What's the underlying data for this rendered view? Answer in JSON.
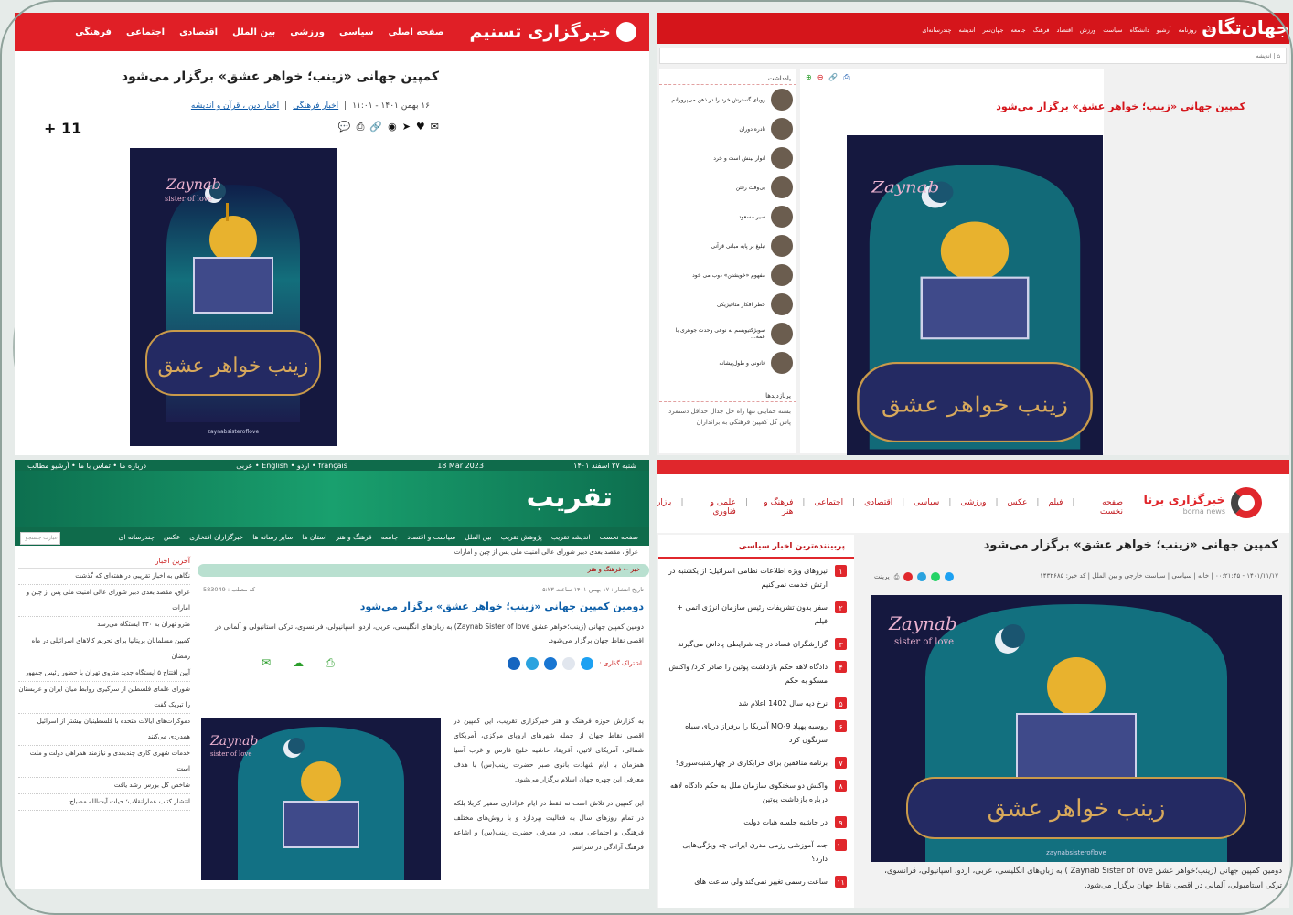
{
  "poster": {
    "brand": "Zaynab",
    "brand_sub": "sister of love",
    "calligraphy": "زینب خواهر عشق",
    "handle": "zaynabsisteroflove"
  },
  "tasnim": {
    "logo": "خبرگزاری تسنیم",
    "nav": [
      "صفحه اصلی",
      "سیاسی",
      "ورزشی",
      "بین الملل",
      "اقتصادی",
      "اجتماعی",
      "فرهنگی"
    ],
    "title": "کمپین جهانی «زینب؛ خواهر عشق» برگزار می‌شود",
    "date": "۱۶ بهمن ۱۴۰۱ - ۱۱:۰۱",
    "cat1": "اخبار فرهنگی",
    "cat2": "اخبار دین ، قرآن و اندیشه",
    "zoom": "+ 11"
  },
  "jahan": {
    "logo": "جهان‌تگان",
    "nav": [
      "خانه",
      "روزنامه",
      "آرشیو",
      "دانشگاه",
      "سیاست",
      "ورزش",
      "اقتصاد",
      "فرهنگ",
      "جامعه",
      "جهان‌نمر",
      "اندیشه",
      "چندرسانه‌ای"
    ],
    "crumb": "اندیشه",
    "title": "کمپین جهانی «زینب؛ خواهر عشق» برگزار می‌شود",
    "sec1": "یادداشت",
    "items": [
      "رویای گسترش خرد را در ذهن می‌پرورانم",
      "نادره دوران",
      "انوار بینش است و خرد",
      "بی‌وقت رفتن",
      "سیر مسعود",
      "تبلیغ بر پایه مبانی قرآنی",
      "مفهوم «خویشتن» دوب می خود",
      "خطر افکار متافیزیکی",
      "سوبژکتیویسم به نوعی وحدت جوهری با عمه...",
      "قانونی و طول‌پیشانه"
    ],
    "sec2": "پربازدیدها",
    "pop": [
      "بسته حمایتی تنها راه حل جدال حداقل دستمزد",
      "پاس گل کمپین فرهنگی به برانداران"
    ]
  },
  "taghrib": {
    "date_fa": "شنبه ۲۷ اسفند ۱۴۰۱",
    "date_en": "18 Mar 2023",
    "langs": "عربی • English • اردو • français",
    "top_links": "درباره ما • تماس با ما • آرشیو مطالب",
    "logo": "تقریب",
    "nav": [
      "صفحه نخست",
      "اندیشه تقریب",
      "پژوهش تقریب",
      "بین الملل",
      "سیاست و اقتصاد",
      "جامعه",
      "فرهنگ و هنر",
      "استان ها",
      "سایر رسانه ها",
      "خبرگزاران افتخاری",
      "عکس",
      "چندرسانه ای"
    ],
    "search_placeholder": "عبارت جستجو",
    "ticker": "عراق، مقصد بعدی دبیر شورای عالی امنیت ملی پس از چین و امارات",
    "crumb": "خبر  ←  فرهنگ و هنر",
    "code": "کد مطلب : 583049",
    "pubdate": "تاریخ انتشار : ۱۷ بهمن ۱۴۰۱ ساعت ۵:۲۳",
    "title": "دومین کمپین جهانی «زینب؛ خواهر عشق» برگزار می‌شود",
    "lead": "دومین کمپین جهانی (زینب؛خواهر عشق Zaynab Sister of love) به زبان‌های انگلیسی، عربی، اردو، اسپانیولی، فرانسوی، ترکی استانبولی و آلمانی در اقصی نقاط جهان برگزار می‌شود.",
    "share": "اشتراک گذاری :",
    "body1": "به گزارش حوزه فرهنگ و هنر خبرگزاری تقریب، این کمپین در اقصی نقاط جهان از جمله شهرهای اروپای مرکزی، آمریکای شمالی، آمریکای لاتین، آفریقا، حاشیه خلیج فارس و غرب آسیا همزمان با ایام شهادت بانوی صبر حضرت زینب(س) با هدف معرفی این چهره جهان اسلام برگزار می‌شود.",
    "body2": "این کمپین در تلاش است نه فقط در ایام عزاداری سفیر کربلا بلکه در تمام روزهای سال به فعالیت بپردازد و با روش‌های مختلف فرهنگی و اجتماعی سعی در معرفی حضرت زینب(س) و اشاعه فرهنگ آزادگی در سراسر",
    "latest_h": "آخرین اخبار",
    "latest": [
      "نگاهی به اخبار تقریبی در هفته‌ای که گذشت",
      "عراق، مقصد بعدی دبیر شورای عالی امنیت ملی پس از چین و امارات",
      "مترو تهران به ۳۳۰ ایستگاه می‌رسد",
      "کمپین مسلمانان بریتانیا برای تحریم کالاهای اسرائیلی در ماه رمضان",
      "آیین افتتاح ۵ ایستگاه جدید متروی تهران با حضور رئیس جمهور",
      "شورای علمای فلسطین از سرگیری روابط میان ایران و عربستان را تبریک گفت",
      "دموکرات‌های ایالات متحده با فلسطینیان بیشتر از اسرائیل همدردی می‌کنند",
      "خدمات شهری کاری چندبعدی و نیازمند همراهی دولت و ملت است",
      "شاخص کل بورس رشد یافت",
      "انتشار کتاب عمارانقلاب؛ حیات آیت‌الله مصباح"
    ]
  },
  "borna": {
    "logo": "خبرگزاری برنا",
    "logo_en": "borna news",
    "nav": [
      "صفحه نخست",
      "فیلم",
      "عکس",
      "ورزشی",
      "سیاسی",
      "اقتصادی",
      "اجتماعی",
      "فرهنگ و هنر",
      "علمی و فناوری",
      "بازار"
    ],
    "title": "کمپین جهانی «زینب؛ خواهر عشق» برگزار می‌شود",
    "meta": "۱۴۰۱/۱۱/۱۷ - ۰۰:۲۱:۴۵ | خانه | سیاسی | سیاست خارجی و بین الملل | کد خبر: ۱۴۳۲۶۸۵",
    "print": "پرینت",
    "caption": "دومین کمپین جهانی (زینب؛خواهر عشق Zaynab Sister of love ) به زبان‌های انگلیسی، عربی، اردو، اسپانیولی، فرانسوی، ترکی استامبولی، آلمانی در اقصی نقاط جهان برگزار می‌شود.",
    "popular_h": "پربیننده‌ترین اخبار سیاسی",
    "popular": [
      {
        "n": "۱",
        "t": "نیروهای ویژه اطلاعات نظامی اسرائیل: از یکشنبه در ارتش خدمت نمی‌کنیم"
      },
      {
        "n": "۲",
        "t": "سفر بدون تشریفات رئیس سازمان انرژی اتمی + فیلم"
      },
      {
        "n": "۳",
        "t": "گزارشگران فساد در چه شرایطی پاداش می‌گیرند"
      },
      {
        "n": "۴",
        "t": "دادگاه لاهه حکم بازداشت پوتین را صادر کرد/ واکنش مسکو به حکم"
      },
      {
        "n": "۵",
        "t": "نرخ دیه سال 1402 اعلام شد"
      },
      {
        "n": "۶",
        "t": "روسیه پهپاد MQ-9 آمریکا را برفراز دریای سیاه سرنگون کرد"
      },
      {
        "n": "۷",
        "t": "برنامه منافقین برای خرابکاری در چهارشنبه‌سوری!"
      },
      {
        "n": "۸",
        "t": "واکنش دو سخنگوی سازمان ملل به حکم دادگاه لاهه درباره بازداشت پوتین"
      },
      {
        "n": "۹",
        "t": "در حاشیه جلسه هیات دولت"
      },
      {
        "n": "۱۰",
        "t": "جت آموزشی رزمی مدرن ایرانی چه ویژگی‌هایی دارد؟"
      },
      {
        "n": "۱۱",
        "t": "ساعت رسمی تغییر نمی‌کند ولی ساعت های"
      }
    ]
  }
}
